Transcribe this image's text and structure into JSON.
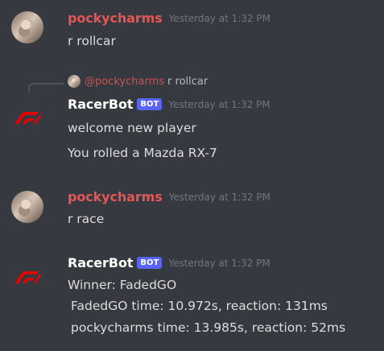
{
  "messages": [
    {
      "author": "pockycharms",
      "timestamp": "Yesterday at 1:32 PM",
      "lines": [
        "r rollcar"
      ]
    },
    {
      "reply": {
        "mention": "@pockycharms",
        "text": "r rollcar"
      },
      "author": "RacerBot",
      "badge": "BOT",
      "timestamp": "Yesterday at 1:32 PM",
      "lines": [
        "welcome new player",
        "You rolled a Mazda RX-7"
      ]
    },
    {
      "author": "pockycharms",
      "timestamp": "Yesterday at 1:32 PM",
      "lines": [
        "r race"
      ]
    },
    {
      "author": "RacerBot",
      "badge": "BOT",
      "timestamp": "Yesterday at 1:32 PM",
      "lines": [
        "Winner: FadedGO",
        "FadedGO time: 10.972s, reaction: 131ms",
        "pockycharms time: 13.985s, reaction: 52ms"
      ]
    }
  ],
  "colors": {
    "background": "#36393f",
    "pockycharms_name": "#e45656",
    "bot_badge": "#5865f2",
    "f1_logo": "#e10600"
  },
  "icons": {
    "user_avatar": "cat-avatar",
    "bot_avatar": "f1-logo-icon"
  }
}
